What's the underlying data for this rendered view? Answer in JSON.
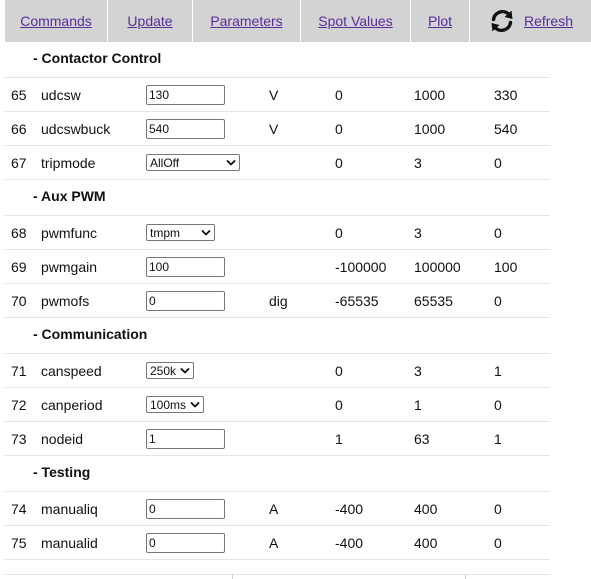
{
  "nav": {
    "tabs": [
      "Commands",
      "Update",
      "Parameters",
      "Spot Values",
      "Plot"
    ],
    "refresh_label": "Refresh",
    "link_color": "#5a2d9c",
    "bar_color": "#d3d3d3"
  },
  "sections": [
    {
      "title": "- Contactor Control",
      "rows": [
        {
          "idx": "65",
          "name": "udcsw",
          "value": "130",
          "kind": "input",
          "unit": "V",
          "min": "0",
          "max": "1000",
          "def": "330"
        },
        {
          "idx": "66",
          "name": "udcswbuck",
          "value": "540",
          "kind": "input",
          "unit": "V",
          "min": "0",
          "max": "1000",
          "def": "540"
        },
        {
          "idx": "67",
          "name": "tripmode",
          "value": "AllOff",
          "kind": "select",
          "unit": "",
          "min": "0",
          "max": "3",
          "def": "0"
        }
      ]
    },
    {
      "title": "- Aux PWM",
      "rows": [
        {
          "idx": "68",
          "name": "pwmfunc",
          "value": "tmpm",
          "kind": "select",
          "unit": "",
          "min": "0",
          "max": "3",
          "def": "0"
        },
        {
          "idx": "69",
          "name": "pwmgain",
          "value": "100",
          "kind": "input",
          "unit": "",
          "min": "-100000",
          "max": "100000",
          "def": "100"
        },
        {
          "idx": "70",
          "name": "pwmofs",
          "value": "0",
          "kind": "input",
          "unit": "dig",
          "min": "-65535",
          "max": "65535",
          "def": "0"
        }
      ]
    },
    {
      "title": "- Communication",
      "rows": [
        {
          "idx": "71",
          "name": "canspeed",
          "value": "250k",
          "kind": "select",
          "unit": "",
          "min": "0",
          "max": "3",
          "def": "1"
        },
        {
          "idx": "72",
          "name": "canperiod",
          "value": "100ms",
          "kind": "select",
          "unit": "",
          "min": "0",
          "max": "1",
          "def": "0"
        },
        {
          "idx": "73",
          "name": "nodeid",
          "value": "1",
          "kind": "input",
          "unit": "",
          "min": "1",
          "max": "63",
          "def": "1"
        }
      ]
    },
    {
      "title": "- Testing",
      "rows": [
        {
          "idx": "74",
          "name": "manualiq",
          "value": "0",
          "kind": "input",
          "unit": "A",
          "min": "-400",
          "max": "400",
          "def": "0"
        },
        {
          "idx": "75",
          "name": "manualid",
          "value": "0",
          "kind": "input",
          "unit": "A",
          "min": "-400",
          "max": "400",
          "def": "0"
        }
      ]
    }
  ]
}
